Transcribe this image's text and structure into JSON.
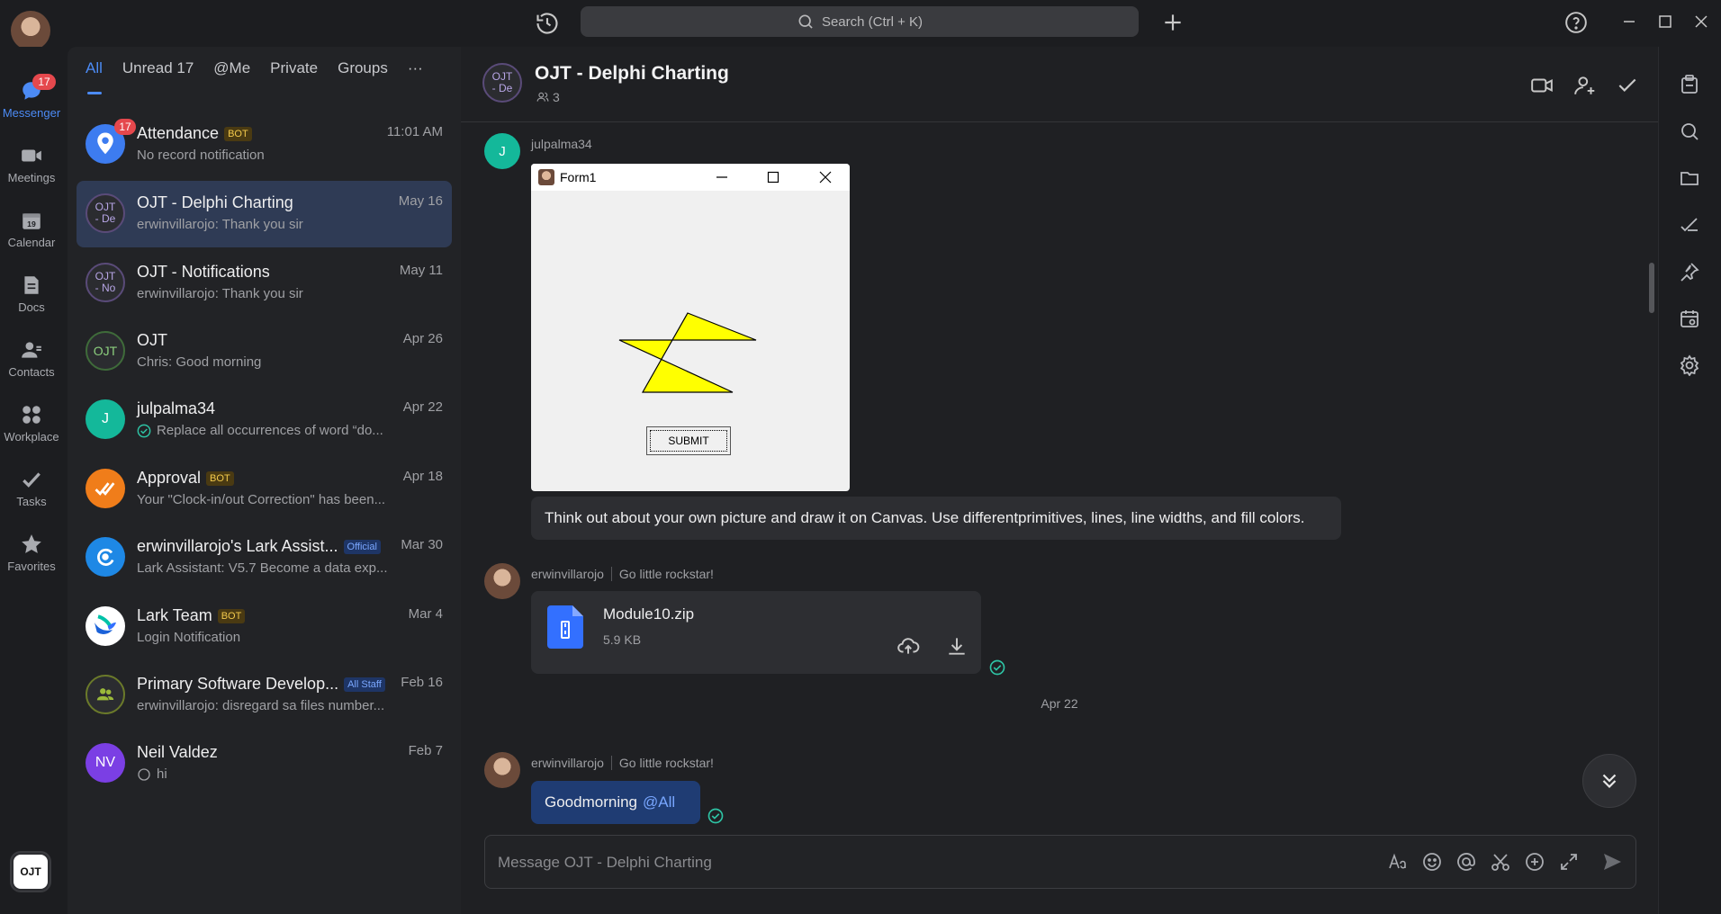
{
  "topbar": {
    "search_placeholder": "Search (Ctrl + K)"
  },
  "rail": {
    "messenger": {
      "label": "Messenger",
      "badge": "17"
    },
    "meetings": {
      "label": "Meetings"
    },
    "calendar": {
      "label": "Calendar",
      "day": "19"
    },
    "docs": {
      "label": "Docs"
    },
    "contacts": {
      "label": "Contacts"
    },
    "workplace": {
      "label": "Workplace"
    },
    "tasks": {
      "label": "Tasks"
    },
    "favorites": {
      "label": "Favorites"
    },
    "org_logo": "OJT"
  },
  "filters": {
    "all": "All",
    "unread": "Unread 17",
    "me": "@Me",
    "private": "Private",
    "groups": "Groups",
    "more": "···"
  },
  "chats": [
    {
      "name": "Attendance",
      "tag": "BOT",
      "preview": "No record notification",
      "time": "11:01 AM",
      "badge": "17"
    },
    {
      "name": "OJT - Delphi Charting",
      "avatar": [
        "OJT",
        "- De"
      ],
      "preview": "erwinvillarojo: Thank you sir",
      "time": "May 16"
    },
    {
      "name": "OJT - Notifications",
      "avatar": [
        "OJT",
        "- No"
      ],
      "preview": "erwinvillarojo: Thank you sir",
      "time": "May 11"
    },
    {
      "name": "OJT",
      "avatar": [
        "OJT"
      ],
      "preview": "Chris: Good morning",
      "time": "Apr 26"
    },
    {
      "name": "julpalma34",
      "avatar": [
        "J"
      ],
      "preview": "Replace all occurrences of word “do...",
      "time": "Apr 22"
    },
    {
      "name": "Approval",
      "tag": "BOT",
      "preview": "Your \"Clock-in/out Correction\" has been...",
      "time": "Apr 18"
    },
    {
      "name": "erwinvillarojo's Lark Assist...",
      "tag": "Official",
      "preview": "Lark Assistant: V5.7 Become a data exp...",
      "time": "Mar 30"
    },
    {
      "name": "Lark Team",
      "tag": "BOT",
      "preview": "Login Notification",
      "time": "Mar 4"
    },
    {
      "name": "Primary Software Develop...",
      "tag": "All Staff",
      "preview": "erwinvillarojo: disregard sa files number...",
      "time": "Feb 16"
    },
    {
      "name": "Neil Valdez",
      "avatar": [
        "NV"
      ],
      "preview": "hi",
      "time": "Feb 7"
    }
  ],
  "conversation": {
    "title": "OJT - Delphi Charting",
    "avatar": [
      "OJT",
      "- De"
    ],
    "member_count": "3",
    "messages": {
      "m1_sender": "julpalma34",
      "m1_avatar": "J",
      "form_title": "Form1",
      "form_button": "SUBMIT",
      "m1_text": "Think out about your own picture and draw it on Canvas. Use differentprimitives, lines, line widths, and fill colors.",
      "m2_sender": "erwinvillarojo",
      "m2_signature": "Go little rockstar!",
      "file_name": "Module10.zip",
      "file_size": "5.9 KB",
      "date_divider": "Apr 22",
      "m3_sender": "erwinvillarojo",
      "m3_signature": "Go little rockstar!",
      "m3_text": "Goodmorning",
      "m3_mention": "@All"
    },
    "composer_placeholder": "Message OJT - Delphi Charting"
  },
  "colors": {
    "accent": "#4c8bf5",
    "badge": "#e5484d",
    "read_tick": "#2ec4a5",
    "star_fill": "#ffff00"
  }
}
